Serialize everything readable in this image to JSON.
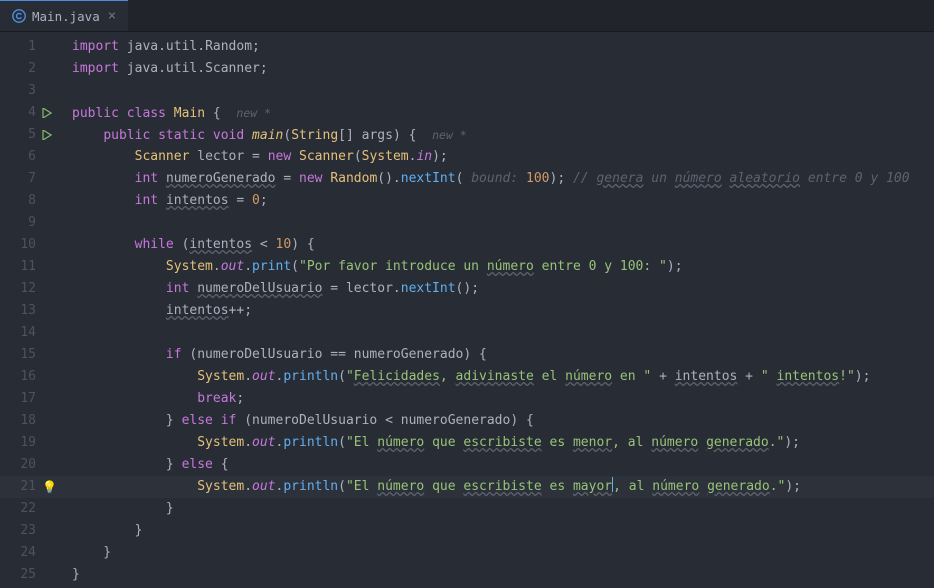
{
  "tab": {
    "filename": "Main.java"
  },
  "lineNumbers": [
    "1",
    "2",
    "3",
    "4",
    "5",
    "6",
    "7",
    "8",
    "9",
    "10",
    "11",
    "12",
    "13",
    "14",
    "15",
    "16",
    "17",
    "18",
    "19",
    "20",
    "21",
    "22",
    "23",
    "24",
    "25"
  ],
  "runLines": [
    4,
    5
  ],
  "bulbLine": 21,
  "highlightLine": 21,
  "code": {
    "import_kw": "import",
    "import1": "java.util.Random",
    "import2": "java.util.Scanner",
    "public": "public",
    "class": "class",
    "Main": "Main",
    "hint_new": "new *",
    "static": "static",
    "void": "void",
    "main": "main",
    "String": "String",
    "args": "args",
    "Scanner": "Scanner",
    "lector": "lector",
    "new": "new",
    "System": "System",
    "in": "in",
    "int": "int",
    "numeroGenerado": "numeroGenerado",
    "Random": "Random",
    "nextInt": "nextInt",
    "bound_hint": "bound:",
    "hundred": "100",
    "comment_gen": "// ",
    "comment_gen_a": "genera",
    "comment_gen_b": " un ",
    "comment_gen_c": "número",
    "comment_gen_d": " ",
    "comment_gen_e": "aleatorio",
    "comment_gen_f": " entre 0 y 100",
    "intentos": "intentos",
    "zero": "0",
    "while": "while",
    "ten": "10",
    "out": "out",
    "print": "print",
    "println": "println",
    "str_prompt_a": "\"Por favor introduce un ",
    "str_prompt_b": "número",
    "str_prompt_c": " entre 0 y 100: \"",
    "numeroDelUsuario": "numeroDelUsuario",
    "if": "if",
    "else": "else",
    "break": "break",
    "str_win_a": "\"",
    "str_win_b": "Felicidades",
    "str_win_c": ", ",
    "str_win_d": "adivinaste",
    "str_win_e": " el ",
    "str_win_f": "número",
    "str_win_g": " en \"",
    "str_win_h": "\" ",
    "str_win_i": "intentos",
    "str_win_j": "!\"",
    "str_low_a": "\"El ",
    "str_low_b": "número",
    "str_low_c": " que ",
    "str_low_d": "escribiste",
    "str_low_e": " es ",
    "str_low_f": "menor",
    "str_low_g": ", al ",
    "str_low_h": "número",
    "str_low_i": " ",
    "str_low_j": "generado",
    "str_low_k": ".\"",
    "str_high_a": "\"El ",
    "str_high_b": "número",
    "str_high_c": " que ",
    "str_high_d": "escribiste",
    "str_high_e": " es ",
    "str_high_f": "mayor",
    "str_high_g": ", al ",
    "str_high_h": "número",
    "str_high_i": " ",
    "str_high_j": "generado",
    "str_high_k": ".\""
  }
}
